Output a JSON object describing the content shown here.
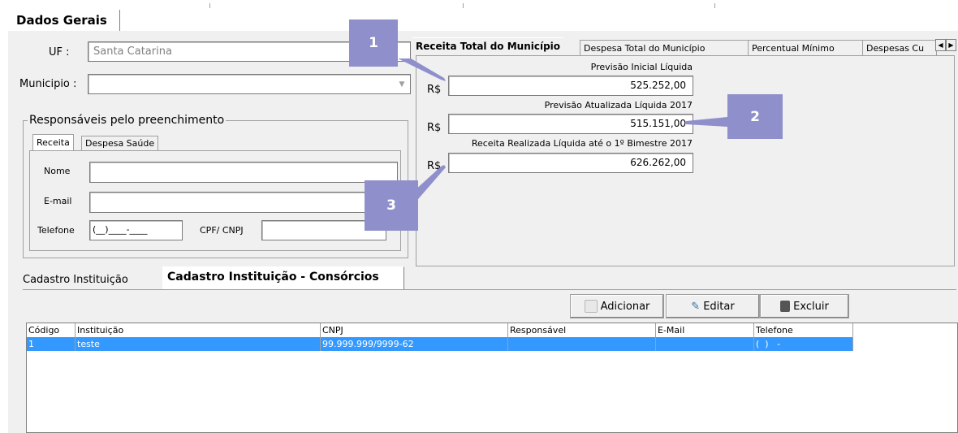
{
  "outer_tab": "Dados Gerais",
  "uf": {
    "label": "UF :",
    "value": "Santa Catarina"
  },
  "municipio": {
    "label": "Municipio :",
    "value": ""
  },
  "responsaveis": {
    "title": "Responsáveis pelo preenchimento",
    "tabs": [
      "Receita",
      "Despesa Saúde"
    ],
    "nome_label": "Nome",
    "email_label": "E-mail",
    "telefone_label": "Telefone",
    "telefone_value": "(__)____-____",
    "cpf_label": "CPF/ CNPJ"
  },
  "right_tabs": [
    "Receita Total do Município",
    "Despesa Total do Município",
    "Percentual Mínimo",
    "Despesas Cu"
  ],
  "receita": {
    "currency": "R$",
    "f1_label": "Previsão Inicial Líquida",
    "f1_value": "525.252,00",
    "f2_label": "Previsão Atualizada Líquida  2017",
    "f2_value": "515.151,00",
    "f3_label": "Receita Realizada Líquida até o 1º Bimestre 2017",
    "f3_value": "626.262,00"
  },
  "bottom_tabs": [
    "Cadastro Instituição",
    "Cadastro Instituição - Consórcios"
  ],
  "buttons": {
    "add": "Adicionar",
    "edit": "Editar",
    "delete": "Excluir"
  },
  "grid": {
    "headers": [
      "Código",
      "Instituição",
      "CNPJ",
      "Responsável",
      "E-Mail",
      "Telefone"
    ],
    "rows": [
      [
        "1",
        "teste",
        "99.999.999/9999-62",
        "",
        "",
        "(  )   -"
      ]
    ]
  },
  "callouts": [
    "1",
    "2",
    "3"
  ],
  "colors": {
    "selection": "#3399ff",
    "callout": "#8f8fcc",
    "panel": "#f0f0f0"
  }
}
